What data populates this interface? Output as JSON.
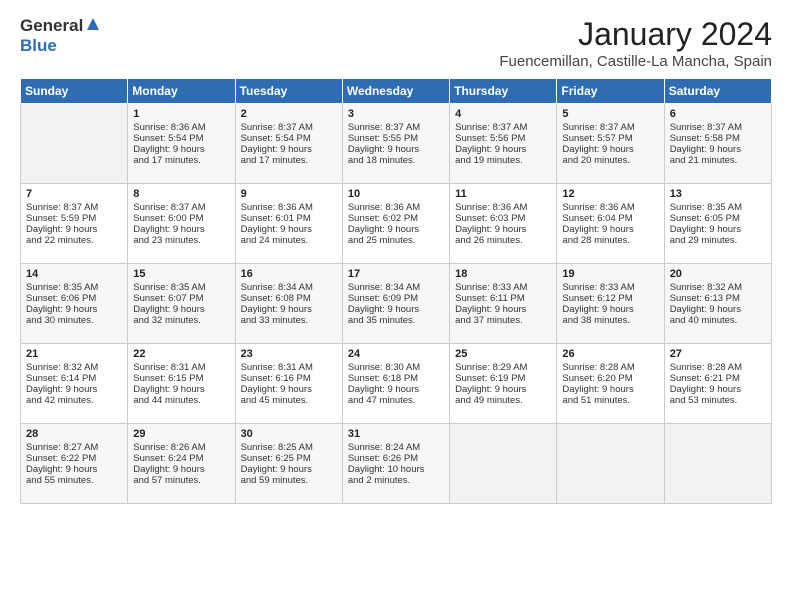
{
  "header": {
    "logo_general": "General",
    "logo_blue": "Blue",
    "title": "January 2024",
    "subtitle": "Fuencemillan, Castille-La Mancha, Spain"
  },
  "days_of_week": [
    "Sunday",
    "Monday",
    "Tuesday",
    "Wednesday",
    "Thursday",
    "Friday",
    "Saturday"
  ],
  "weeks": [
    [
      {
        "num": "",
        "lines": []
      },
      {
        "num": "1",
        "lines": [
          "Sunrise: 8:36 AM",
          "Sunset: 5:54 PM",
          "Daylight: 9 hours",
          "and 17 minutes."
        ]
      },
      {
        "num": "2",
        "lines": [
          "Sunrise: 8:37 AM",
          "Sunset: 5:54 PM",
          "Daylight: 9 hours",
          "and 17 minutes."
        ]
      },
      {
        "num": "3",
        "lines": [
          "Sunrise: 8:37 AM",
          "Sunset: 5:55 PM",
          "Daylight: 9 hours",
          "and 18 minutes."
        ]
      },
      {
        "num": "4",
        "lines": [
          "Sunrise: 8:37 AM",
          "Sunset: 5:56 PM",
          "Daylight: 9 hours",
          "and 19 minutes."
        ]
      },
      {
        "num": "5",
        "lines": [
          "Sunrise: 8:37 AM",
          "Sunset: 5:57 PM",
          "Daylight: 9 hours",
          "and 20 minutes."
        ]
      },
      {
        "num": "6",
        "lines": [
          "Sunrise: 8:37 AM",
          "Sunset: 5:58 PM",
          "Daylight: 9 hours",
          "and 21 minutes."
        ]
      }
    ],
    [
      {
        "num": "7",
        "lines": [
          "Sunrise: 8:37 AM",
          "Sunset: 5:59 PM",
          "Daylight: 9 hours",
          "and 22 minutes."
        ]
      },
      {
        "num": "8",
        "lines": [
          "Sunrise: 8:37 AM",
          "Sunset: 6:00 PM",
          "Daylight: 9 hours",
          "and 23 minutes."
        ]
      },
      {
        "num": "9",
        "lines": [
          "Sunrise: 8:36 AM",
          "Sunset: 6:01 PM",
          "Daylight: 9 hours",
          "and 24 minutes."
        ]
      },
      {
        "num": "10",
        "lines": [
          "Sunrise: 8:36 AM",
          "Sunset: 6:02 PM",
          "Daylight: 9 hours",
          "and 25 minutes."
        ]
      },
      {
        "num": "11",
        "lines": [
          "Sunrise: 8:36 AM",
          "Sunset: 6:03 PM",
          "Daylight: 9 hours",
          "and 26 minutes."
        ]
      },
      {
        "num": "12",
        "lines": [
          "Sunrise: 8:36 AM",
          "Sunset: 6:04 PM",
          "Daylight: 9 hours",
          "and 28 minutes."
        ]
      },
      {
        "num": "13",
        "lines": [
          "Sunrise: 8:35 AM",
          "Sunset: 6:05 PM",
          "Daylight: 9 hours",
          "and 29 minutes."
        ]
      }
    ],
    [
      {
        "num": "14",
        "lines": [
          "Sunrise: 8:35 AM",
          "Sunset: 6:06 PM",
          "Daylight: 9 hours",
          "and 30 minutes."
        ]
      },
      {
        "num": "15",
        "lines": [
          "Sunrise: 8:35 AM",
          "Sunset: 6:07 PM",
          "Daylight: 9 hours",
          "and 32 minutes."
        ]
      },
      {
        "num": "16",
        "lines": [
          "Sunrise: 8:34 AM",
          "Sunset: 6:08 PM",
          "Daylight: 9 hours",
          "and 33 minutes."
        ]
      },
      {
        "num": "17",
        "lines": [
          "Sunrise: 8:34 AM",
          "Sunset: 6:09 PM",
          "Daylight: 9 hours",
          "and 35 minutes."
        ]
      },
      {
        "num": "18",
        "lines": [
          "Sunrise: 8:33 AM",
          "Sunset: 6:11 PM",
          "Daylight: 9 hours",
          "and 37 minutes."
        ]
      },
      {
        "num": "19",
        "lines": [
          "Sunrise: 8:33 AM",
          "Sunset: 6:12 PM",
          "Daylight: 9 hours",
          "and 38 minutes."
        ]
      },
      {
        "num": "20",
        "lines": [
          "Sunrise: 8:32 AM",
          "Sunset: 6:13 PM",
          "Daylight: 9 hours",
          "and 40 minutes."
        ]
      }
    ],
    [
      {
        "num": "21",
        "lines": [
          "Sunrise: 8:32 AM",
          "Sunset: 6:14 PM",
          "Daylight: 9 hours",
          "and 42 minutes."
        ]
      },
      {
        "num": "22",
        "lines": [
          "Sunrise: 8:31 AM",
          "Sunset: 6:15 PM",
          "Daylight: 9 hours",
          "and 44 minutes."
        ]
      },
      {
        "num": "23",
        "lines": [
          "Sunrise: 8:31 AM",
          "Sunset: 6:16 PM",
          "Daylight: 9 hours",
          "and 45 minutes."
        ]
      },
      {
        "num": "24",
        "lines": [
          "Sunrise: 8:30 AM",
          "Sunset: 6:18 PM",
          "Daylight: 9 hours",
          "and 47 minutes."
        ]
      },
      {
        "num": "25",
        "lines": [
          "Sunrise: 8:29 AM",
          "Sunset: 6:19 PM",
          "Daylight: 9 hours",
          "and 49 minutes."
        ]
      },
      {
        "num": "26",
        "lines": [
          "Sunrise: 8:28 AM",
          "Sunset: 6:20 PM",
          "Daylight: 9 hours",
          "and 51 minutes."
        ]
      },
      {
        "num": "27",
        "lines": [
          "Sunrise: 8:28 AM",
          "Sunset: 6:21 PM",
          "Daylight: 9 hours",
          "and 53 minutes."
        ]
      }
    ],
    [
      {
        "num": "28",
        "lines": [
          "Sunrise: 8:27 AM",
          "Sunset: 6:22 PM",
          "Daylight: 9 hours",
          "and 55 minutes."
        ]
      },
      {
        "num": "29",
        "lines": [
          "Sunrise: 8:26 AM",
          "Sunset: 6:24 PM",
          "Daylight: 9 hours",
          "and 57 minutes."
        ]
      },
      {
        "num": "30",
        "lines": [
          "Sunrise: 8:25 AM",
          "Sunset: 6:25 PM",
          "Daylight: 9 hours",
          "and 59 minutes."
        ]
      },
      {
        "num": "31",
        "lines": [
          "Sunrise: 8:24 AM",
          "Sunset: 6:26 PM",
          "Daylight: 10 hours",
          "and 2 minutes."
        ]
      },
      {
        "num": "",
        "lines": []
      },
      {
        "num": "",
        "lines": []
      },
      {
        "num": "",
        "lines": []
      }
    ]
  ]
}
